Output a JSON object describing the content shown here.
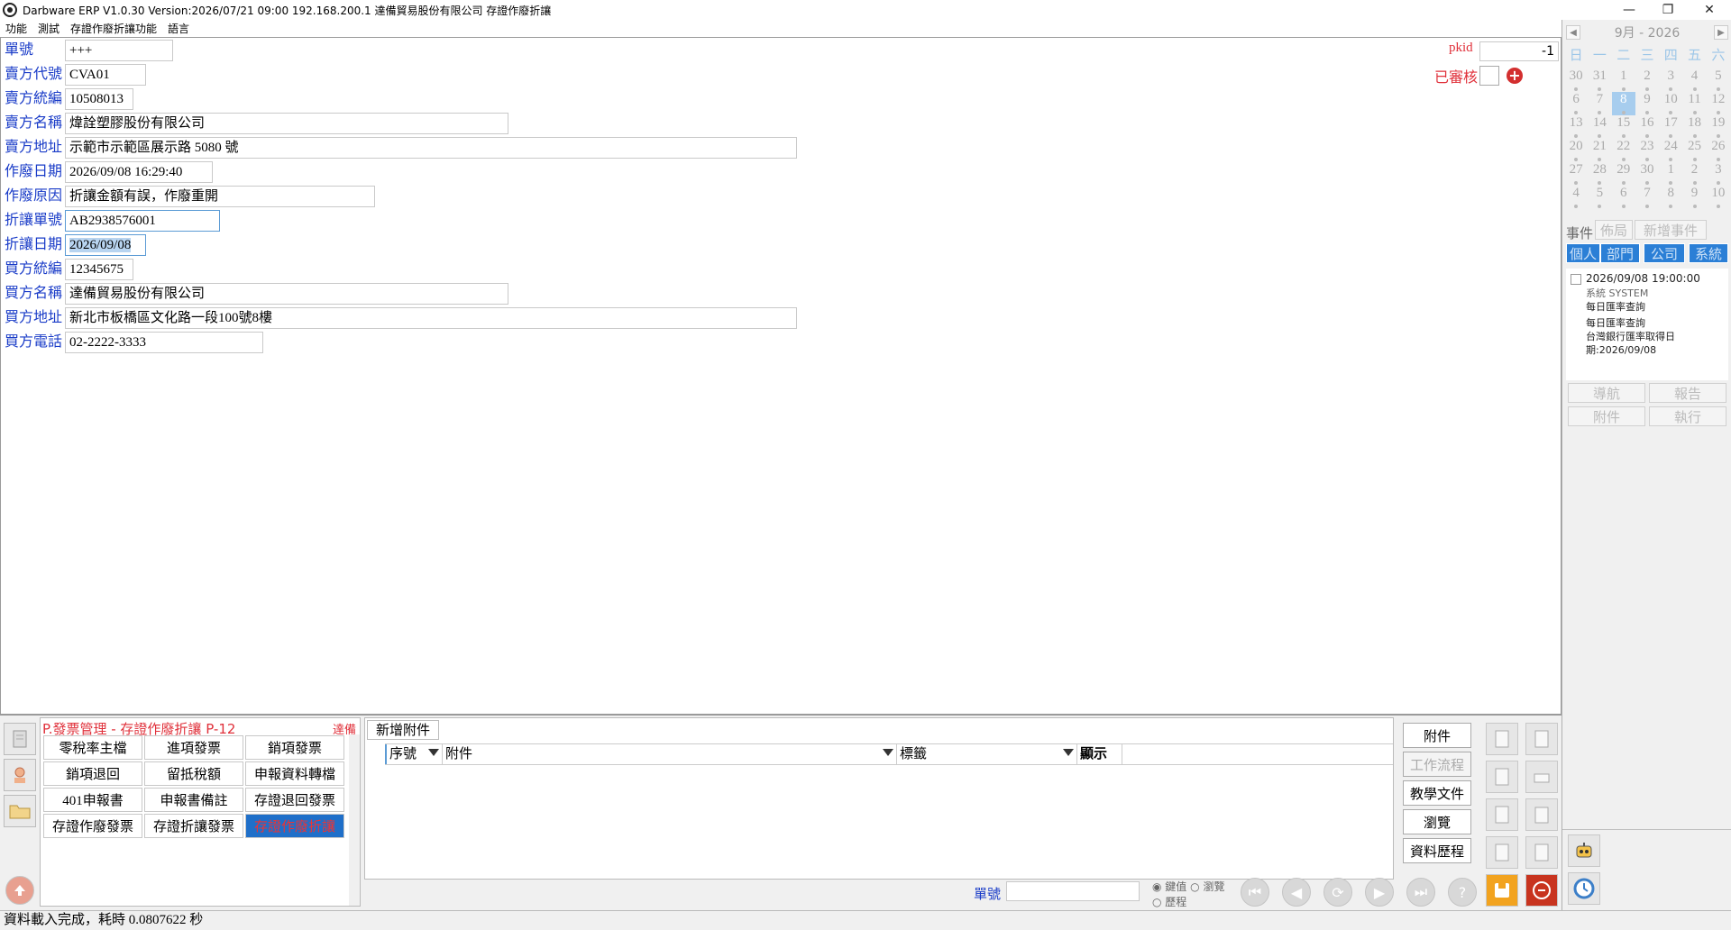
{
  "window": {
    "title": "Darbware ERP V1.0.30 Version:2026/07/21 09:00   192.168.200.1 達備貿易股份有限公司 存證作廢折讓",
    "min": "—",
    "max": "❐",
    "close": "✕"
  },
  "menu": [
    "功能",
    "測試",
    "存證作廢折讓功能",
    "語言"
  ],
  "form": {
    "fields": [
      {
        "label": "單號",
        "value": "+++"
      },
      {
        "label": "賣方代號",
        "value": "CVA01"
      },
      {
        "label": "賣方統編",
        "value": "10508013"
      },
      {
        "label": "賣方名稱",
        "value": "煒詮塑膠股份有限公司"
      },
      {
        "label": "賣方地址",
        "value": "示範市示範區展示路 5080 號"
      },
      {
        "label": "作廢日期",
        "value": "2026/09/08 16:29:40"
      },
      {
        "label": "作廢原因",
        "value": "折讓金額有誤，作廢重開"
      },
      {
        "label": "折讓單號",
        "value": "AB2938576001"
      },
      {
        "label": "折讓日期",
        "value": "2026/09/08"
      },
      {
        "label": "買方統編",
        "value": "12345675"
      },
      {
        "label": "買方名稱",
        "value": "達備貿易股份有限公司"
      },
      {
        "label": "買方地址",
        "value": "新北市板橋區文化路一段100號8樓"
      },
      {
        "label": "買方電話",
        "value": "02-2222-3333"
      }
    ],
    "pkid_label": "pkid",
    "pkid_value": "-1",
    "approved_label": "已審核",
    "add_icon": "plus-circle-icon"
  },
  "calendar": {
    "prev": "◀",
    "next": "▶",
    "month": "9月",
    "sep": "-",
    "year": "2026",
    "weekdays": [
      "日",
      "一",
      "二",
      "三",
      "四",
      "五",
      "六"
    ],
    "weeks": [
      [
        "30",
        "31",
        "1",
        "2",
        "3",
        "4",
        "5"
      ],
      [
        "6",
        "7",
        "8",
        "9",
        "10",
        "11",
        "12"
      ],
      [
        "13",
        "14",
        "15",
        "16",
        "17",
        "18",
        "19"
      ],
      [
        "20",
        "21",
        "22",
        "23",
        "24",
        "25",
        "26"
      ],
      [
        "27",
        "28",
        "29",
        "30",
        "1",
        "2",
        "3"
      ],
      [
        "4",
        "5",
        "6",
        "7",
        "8",
        "9",
        "10"
      ]
    ],
    "today": "8"
  },
  "events_panel": {
    "label": "事件",
    "layout_btn": "佈局",
    "add_btn": "新增事件",
    "tabs": [
      "個人",
      "部門",
      "公司",
      "系統"
    ],
    "event": {
      "time": "2026/09/08 19:00:00",
      "owner": "系統 SYSTEM",
      "title": "每日匯率查詢",
      "desc1": "每日匯率查詢",
      "desc2": "台灣銀行匯率取得日",
      "desc3": "期:2026/09/08"
    },
    "actions": [
      "導航",
      "報告",
      "附件",
      "執行"
    ]
  },
  "module": {
    "title": "P.發票管理 - 存證作廢折讓  P-12",
    "company": "達備",
    "buttons": [
      "零稅率主檔",
      "進項發票",
      "銷項發票",
      "銷項退回",
      "留抵稅額",
      "申報資料轉檔",
      "401申報書",
      "申報書備註",
      "存證退回發票",
      "存證作廢發票",
      "存證折讓發票",
      "存證作廢折讓"
    ],
    "active": "存證作廢折讓"
  },
  "attachments": {
    "add_tab": "新增附件",
    "columns": [
      "序號",
      "附件",
      "標籤",
      "顯示"
    ]
  },
  "right_actions": [
    "附件",
    "工作流程",
    "教學文件",
    "瀏覽",
    "資料歷程"
  ],
  "navigator": {
    "no_label": "單號",
    "no_value": "",
    "radio1": "鍵值",
    "radio2": "瀏覽",
    "radio3": "歷程"
  },
  "status": "資料載入完成，耗時 0.0807622 秒"
}
